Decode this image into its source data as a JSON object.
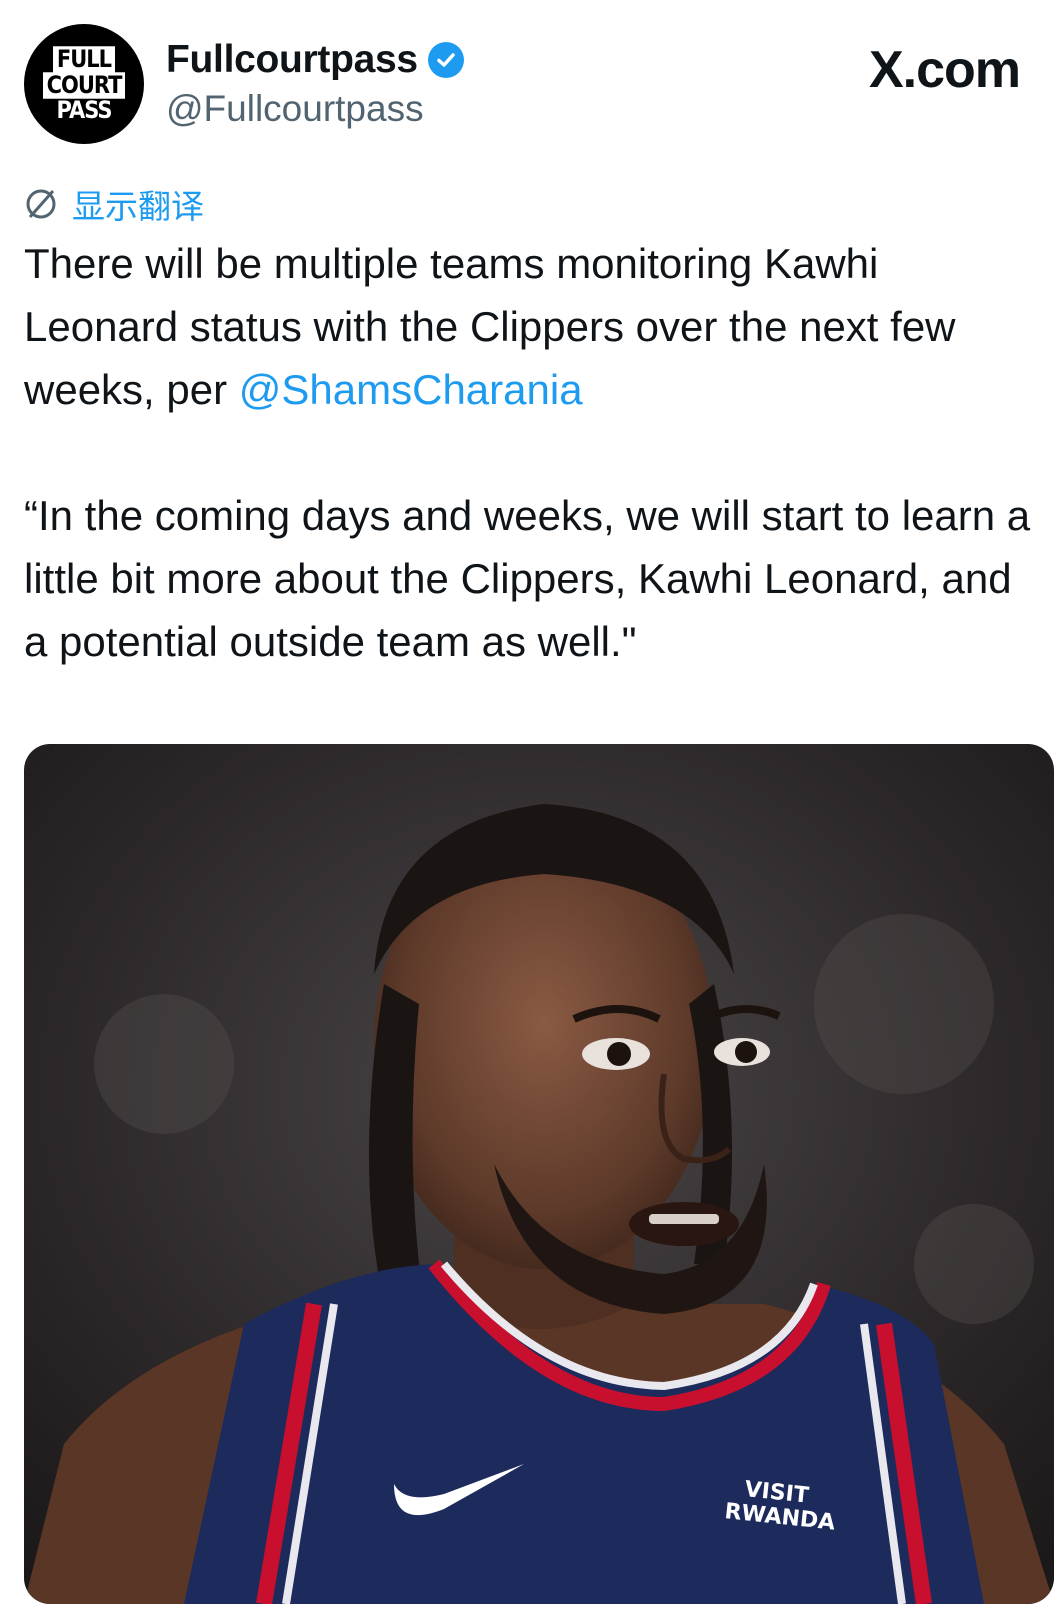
{
  "author": {
    "avatar_lines": [
      "FULL",
      "COURT",
      "PASS"
    ],
    "display_name": "Fullcourtpass",
    "handle": "@Fullcourtpass",
    "verified": true
  },
  "source": {
    "label": "X.com"
  },
  "translate": {
    "label": "显示翻译",
    "icon": "translate-globe-icon"
  },
  "tweet": {
    "line1_part1": "There will be multiple teams monitoring Kawhi Leonard status with the Clippers over the next few weeks, per ",
    "mention": "@ShamsCharania",
    "quote": "“In the coming days and weeks, we will start to learn a little bit more about the Clippers, Kawhi Leonard, and a potential outside team as well.\""
  },
  "photo": {
    "jersey_text_1": "VISIT",
    "jersey_text_2": "RWANDA"
  },
  "colors": {
    "link": "#1d9bf0",
    "text": "#0f1419",
    "secondary": "#536471",
    "jersey_navy": "#1d2a5c",
    "jersey_red": "#c8102e"
  }
}
